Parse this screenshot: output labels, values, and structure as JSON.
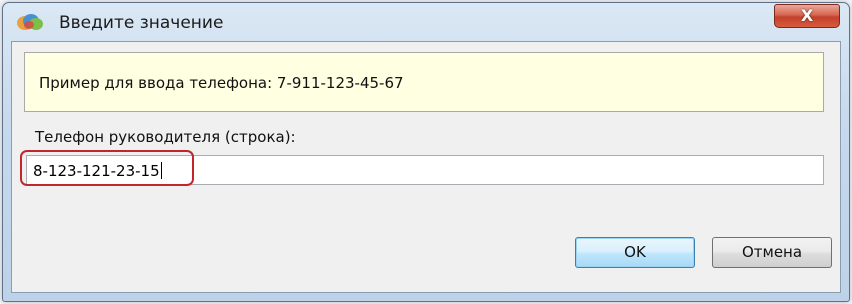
{
  "window": {
    "title": "Введите значение",
    "close_glyph": "X",
    "icon": "app-icon"
  },
  "hint": {
    "text": "Пример для ввода телефона: 7-911-123-45-67"
  },
  "field": {
    "label": "Телефон руководителя (строка):",
    "value": "8-123-121-23-15"
  },
  "buttons": {
    "ok_label": "OK",
    "cancel_label": "Отмена"
  },
  "colors": {
    "hint_background": "#ffffe1",
    "highlight_outline": "#c0262c",
    "close_button": "#c4402a",
    "ok_border": "#3c7fb1"
  }
}
